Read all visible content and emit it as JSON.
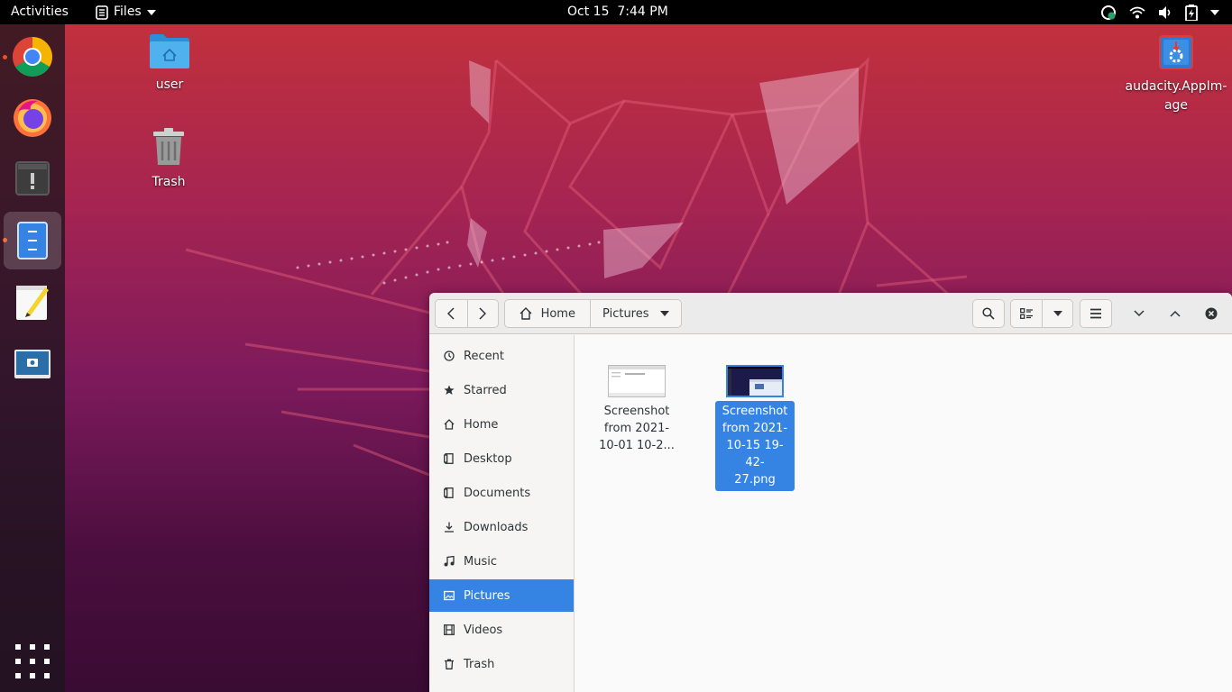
{
  "topbar": {
    "activities": "Activities",
    "app_menu": "Files",
    "clock": "Oct 15  7:44 PM"
  },
  "dock": {
    "items": [
      {
        "name": "Google Chrome",
        "icon": "chrome-icon",
        "running": true
      },
      {
        "name": "Firefox",
        "icon": "firefox-icon",
        "running": false
      },
      {
        "name": "Software Updater",
        "icon": "updater-icon",
        "running": false
      },
      {
        "name": "Files",
        "icon": "files-icon",
        "running": true,
        "active": true
      },
      {
        "name": "Text Editor",
        "icon": "text-editor-icon",
        "running": false
      },
      {
        "name": "Screenshot",
        "icon": "screenshot-icon",
        "running": false
      }
    ]
  },
  "desktop": {
    "icons": [
      {
        "label": "user",
        "icon": "home-folder-icon"
      },
      {
        "label": "Trash",
        "icon": "trash-icon"
      },
      {
        "label": "audacity.AppIm-age",
        "icon": "appimage-icon"
      }
    ]
  },
  "window": {
    "path": [
      "Home",
      "Pictures"
    ],
    "sidebar": [
      {
        "label": "Recent",
        "icon": "clock-icon"
      },
      {
        "label": "Starred",
        "icon": "star-icon"
      },
      {
        "label": "Home",
        "icon": "home-icon"
      },
      {
        "label": "Desktop",
        "icon": "desktop-icon"
      },
      {
        "label": "Documents",
        "icon": "documents-icon"
      },
      {
        "label": "Downloads",
        "icon": "download-icon"
      },
      {
        "label": "Music",
        "icon": "music-icon"
      },
      {
        "label": "Pictures",
        "icon": "pictures-icon",
        "selected": true
      },
      {
        "label": "Videos",
        "icon": "videos-icon"
      },
      {
        "label": "Trash",
        "icon": "trash-icon"
      }
    ],
    "files": [
      {
        "name_lines": [
          "Screenshot",
          "from 2021-",
          "10-01 10-2..."
        ],
        "selected": false
      },
      {
        "name_lines": [
          "Screenshot",
          "from 2021-",
          "10-15 19-42-",
          "27.png"
        ],
        "selected": true
      }
    ]
  },
  "colors": {
    "accent": "#3584e4",
    "ubuntu_orange": "#e95420",
    "topbar": "#000000"
  }
}
